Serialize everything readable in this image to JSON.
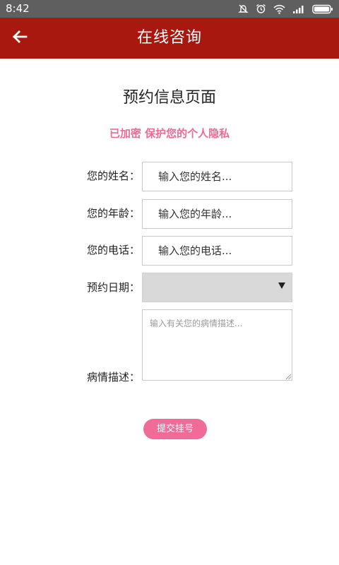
{
  "status_bar": {
    "time": "8:42",
    "icons": [
      "bell-off-icon",
      "alarm-icon",
      "wifi-icon",
      "signal-icon",
      "battery-icon"
    ]
  },
  "header": {
    "title": "在线咨询",
    "back_icon": "arrow-left-icon",
    "background_color": "#a8180e"
  },
  "form": {
    "heading": "预约信息页面",
    "privacy_note": "已加密 保护您的个人隐私",
    "fields": {
      "name": {
        "label": "您的姓名：",
        "placeholder": "输入您的姓名..."
      },
      "age": {
        "label": "您的年龄：",
        "placeholder": "输入您的年龄..."
      },
      "phone": {
        "label": "您的电话：",
        "placeholder": "输入您的电话..."
      },
      "date": {
        "label": "预约日期：",
        "selected_value": ""
      },
      "description": {
        "label": "病情描述：",
        "placeholder": "输入有关您的病情描述..."
      }
    },
    "submit_label": "提交挂号",
    "accent_color": "#f06b97"
  }
}
